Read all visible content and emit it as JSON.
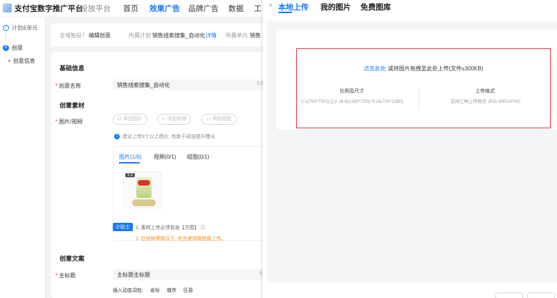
{
  "nav": {
    "brand": "支付宝数字推广平台",
    "sub": "投放平台",
    "items": [
      "首页",
      "效果广告",
      "品牌广告",
      "数据",
      "工"
    ]
  },
  "steps": {
    "done": "计划&单元",
    "current_num": "2",
    "current": "创意",
    "sub": "创意信息"
  },
  "breadcrumb": {
    "path1": "全域智投",
    "sep": "/",
    "path2": "编辑创意",
    "plan_label": "所属计划",
    "plan_value": "销售线索搜集_自动化",
    "detail": "详情",
    "unit_label": "所属单元",
    "unit_value": "销售"
  },
  "form": {
    "basic_title": "基础信息",
    "name_label": "创意名称",
    "name_value": "销售线索搜集_自动化",
    "name_count": "9.5",
    "material_title": "创意素材",
    "media_label": "图片/视频",
    "btn_add_image": "添加图片",
    "btn_add_video": "添加视频",
    "btn_add_group": "添加组图",
    "hint": "建议上传3个以上图片, 有助于成倍提升曝光",
    "tabs": [
      "图片(1/6)",
      "视频(0/1)",
      "组图(0/1)"
    ],
    "thumb_ratio": "1:1",
    "tip_badge": "小贴士",
    "tip1": "1. 素材上传必须包含【方图】",
    "tip2": "2. 在视频等情况下, 优先使用跳图像上传。",
    "copy_title": "创意文案",
    "headline_label": "主标题",
    "headline_value": "主标题主标题",
    "headline_count": "6.",
    "insert_label": "插入动态词包:",
    "insert_tags": [
      "省份",
      "城市",
      "区县"
    ]
  },
  "panel": {
    "close": "×",
    "tabs": [
      "本地上传",
      "我的图片",
      "免费图库"
    ],
    "upload_link": "点击此处",
    "upload_text": "或将图片拖拽至此处上传(文件≤300KB)",
    "ratio_title": "比例及尺寸",
    "ratio_value": "1:1(750*750以上)/ 16:9(1280*720)/ 9:16(720*1280)",
    "format_title": "上传格式",
    "format_value": "支持三种上传格式 JPG/JPEG/PNG"
  }
}
